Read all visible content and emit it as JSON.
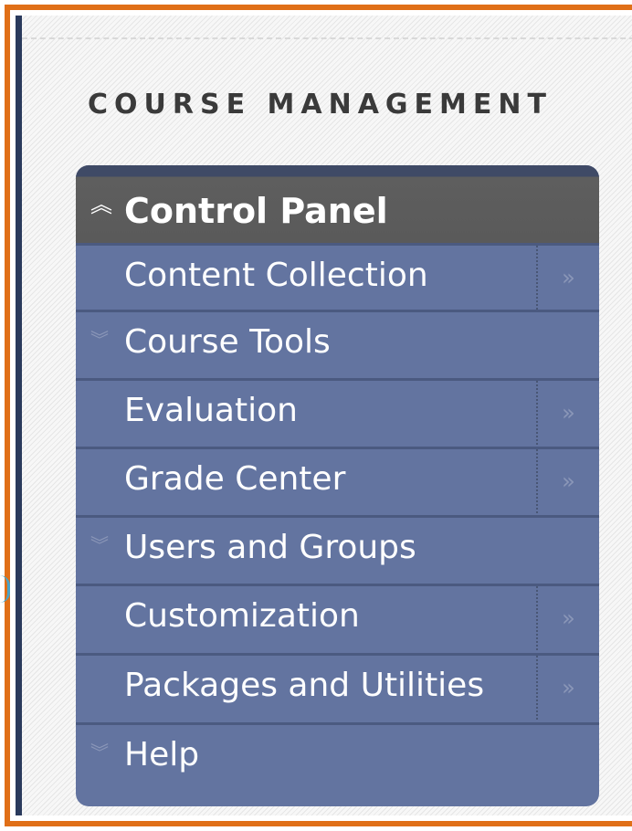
{
  "section_title": "COURSE MANAGEMENT",
  "control_panel": {
    "header_label": "Control Panel",
    "collapse_icon": "double-chevron-up-icon",
    "items": [
      {
        "label": "Content Collection",
        "type": "link",
        "has_arrow": true
      },
      {
        "label": "Course Tools",
        "type": "expandable",
        "has_arrow": false
      },
      {
        "label": "Evaluation",
        "type": "link",
        "has_arrow": true
      },
      {
        "label": "Grade Center",
        "type": "link",
        "has_arrow": true
      },
      {
        "label": "Users and Groups",
        "type": "expandable",
        "has_arrow": false
      },
      {
        "label": "Customization",
        "type": "link",
        "has_arrow": true
      },
      {
        "label": "Packages and Utilities",
        "type": "link",
        "has_arrow": true
      },
      {
        "label": "Help",
        "type": "expandable",
        "has_arrow": false
      }
    ],
    "arrow_glyph": "»",
    "expand_glyph": "≫",
    "collapse_glyph": "︽"
  },
  "colors": {
    "frame_border": "#e06f17",
    "side_bar": "#2a3a5c",
    "menu_bg": "#6374a0",
    "header_bg": "#5a5a5a",
    "text": "#ffffff"
  }
}
